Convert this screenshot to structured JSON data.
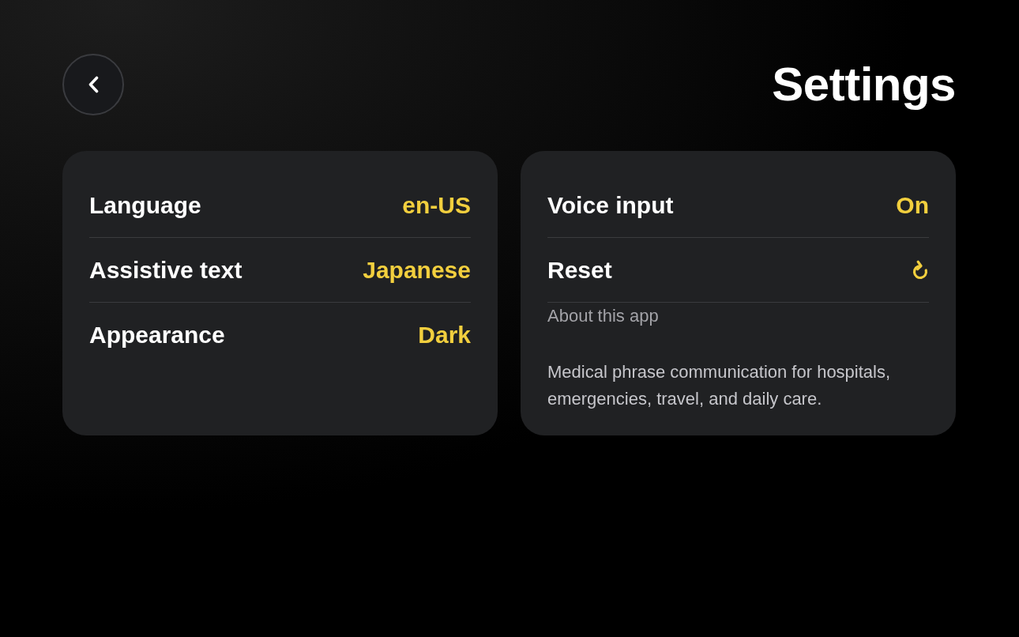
{
  "header": {
    "title": "Settings"
  },
  "cards": [
    {
      "rows": [
        {
          "kind": "value",
          "label": "Language",
          "value": "en-US"
        },
        {
          "kind": "value",
          "label": "Assistive text",
          "value": "Japanese"
        },
        {
          "kind": "value",
          "label": "Appearance",
          "value": "Dark"
        }
      ]
    },
    {
      "rows": [
        {
          "kind": "value",
          "label": "Voice input",
          "value": "On"
        },
        {
          "kind": "action",
          "label": "Reset"
        }
      ],
      "about": {
        "heading": "About this app",
        "text": "Medical phrase communication for hospitals, emergencies, travel, and daily care."
      }
    }
  ]
}
